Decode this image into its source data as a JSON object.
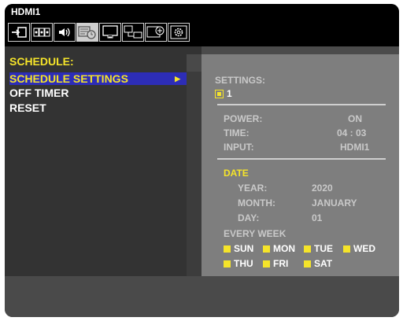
{
  "header": {
    "title": "HDMI1"
  },
  "icons": [
    "input-icon",
    "picture-icon",
    "audio-icon",
    "schedule-icon",
    "display-icon",
    "network-icon",
    "protect-icon",
    "system-icon"
  ],
  "left_menu": {
    "heading": "SCHEDULE:",
    "items": [
      {
        "label": "SCHEDULE SETTINGS",
        "selected": true
      },
      {
        "label": "OFF TIMER",
        "selected": false
      },
      {
        "label": "RESET",
        "selected": false
      }
    ]
  },
  "settings": {
    "label": "SETTINGS:",
    "slot": "1",
    "power_label": "POWER:",
    "power_value": "ON",
    "time_label": "TIME:",
    "time_value": "04 : 03",
    "input_label": "INPUT:",
    "input_value": "HDMI1",
    "date_label": "DATE",
    "year_label": "YEAR:",
    "year_value": "2020",
    "month_label": "MONTH:",
    "month_value": "JANUARY",
    "day_label": "DAY:",
    "day_value": "01",
    "every_week_label": "EVERY WEEK",
    "days": [
      "SUN",
      "MON",
      "TUE",
      "WED",
      "THU",
      "FRI",
      "SAT"
    ]
  },
  "colors": {
    "highlight": "#2d2db7",
    "accent": "#f5e42a",
    "panel": "#7e7e7e"
  }
}
